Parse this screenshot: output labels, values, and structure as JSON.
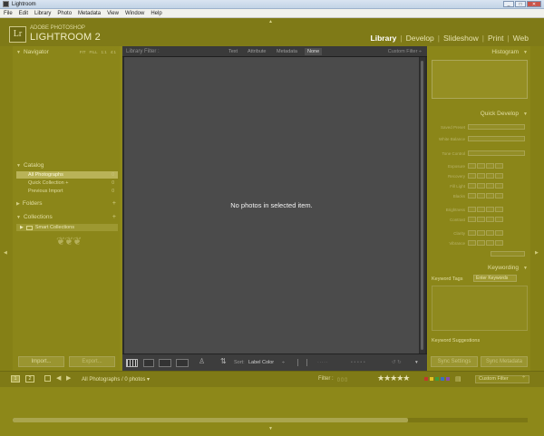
{
  "window": {
    "title": "Lightroom"
  },
  "menubar": [
    "File",
    "Edit",
    "Library",
    "Photo",
    "Metadata",
    "View",
    "Window",
    "Help"
  ],
  "brand": {
    "logo": "Lr",
    "small": "ADOBE PHOTOSHOP",
    "big": "LIGHTROOM 2"
  },
  "modules": [
    {
      "label": "Library",
      "active": true
    },
    {
      "label": "Develop",
      "active": false
    },
    {
      "label": "Slideshow",
      "active": false
    },
    {
      "label": "Print",
      "active": false
    },
    {
      "label": "Web",
      "active": false
    }
  ],
  "left_panel": {
    "navigator": {
      "title": "Navigator",
      "options": [
        "FIT",
        "FILL",
        "1:1",
        "4:1"
      ]
    },
    "catalog": {
      "title": "Catalog",
      "items": [
        {
          "label": "All Photographs",
          "count": "0",
          "selected": true
        },
        {
          "label": "Quick Collection +",
          "count": "0",
          "selected": false
        },
        {
          "label": "Previous Import",
          "count": "0",
          "selected": false
        }
      ]
    },
    "folders": {
      "title": "Folders"
    },
    "collections": {
      "title": "Collections",
      "items": [
        {
          "label": "Smart Collections"
        }
      ]
    },
    "import_button": "Import...",
    "export_button": "Export..."
  },
  "center": {
    "filter_bar": {
      "label": "Library Filter :",
      "tabs": [
        {
          "label": "Text",
          "active": false
        },
        {
          "label": "Attribute",
          "active": false
        },
        {
          "label": "Metadata",
          "active": false
        },
        {
          "label": "None",
          "active": true
        }
      ],
      "custom": "Custom Filter ÷"
    },
    "empty_message": "No photos in selected item.",
    "toolbar": {
      "sort_label": "Sort:",
      "sort_value": "Label Color"
    }
  },
  "right_panel": {
    "histogram": {
      "title": "Histogram"
    },
    "quick_develop": {
      "title": "Quick Develop",
      "rows": [
        "Saved Preset",
        "White Balance",
        "Tone Control",
        "Exposure",
        "Recovery",
        "Fill Light",
        "Blacks",
        "Brightness",
        "Contrast",
        "Clarity",
        "Vibrance"
      ]
    },
    "keywording": {
      "title": "Keywording",
      "keyword_tags_label": "Keyword Tags",
      "keyword_tags_value": "Enter Keywords",
      "suggestions": "Keyword Suggestions"
    },
    "sync_settings": "Sync Settings",
    "sync_metadata": "Sync Metadata"
  },
  "filmstrip_bar": {
    "pages": [
      "1",
      "2"
    ],
    "source": "All Photographs / 0 photos ▾",
    "filter_label": "Filter :",
    "stars": "★★★★★",
    "custom_filter": "Custom Filter"
  },
  "colors": {
    "overlay": "#8f8a1a",
    "center_bg": "#4b4b4b",
    "label_colors": [
      "#c0392b",
      "#e0c020",
      "#3c9a3c",
      "#3a6fc0",
      "#8a4ab0"
    ]
  }
}
